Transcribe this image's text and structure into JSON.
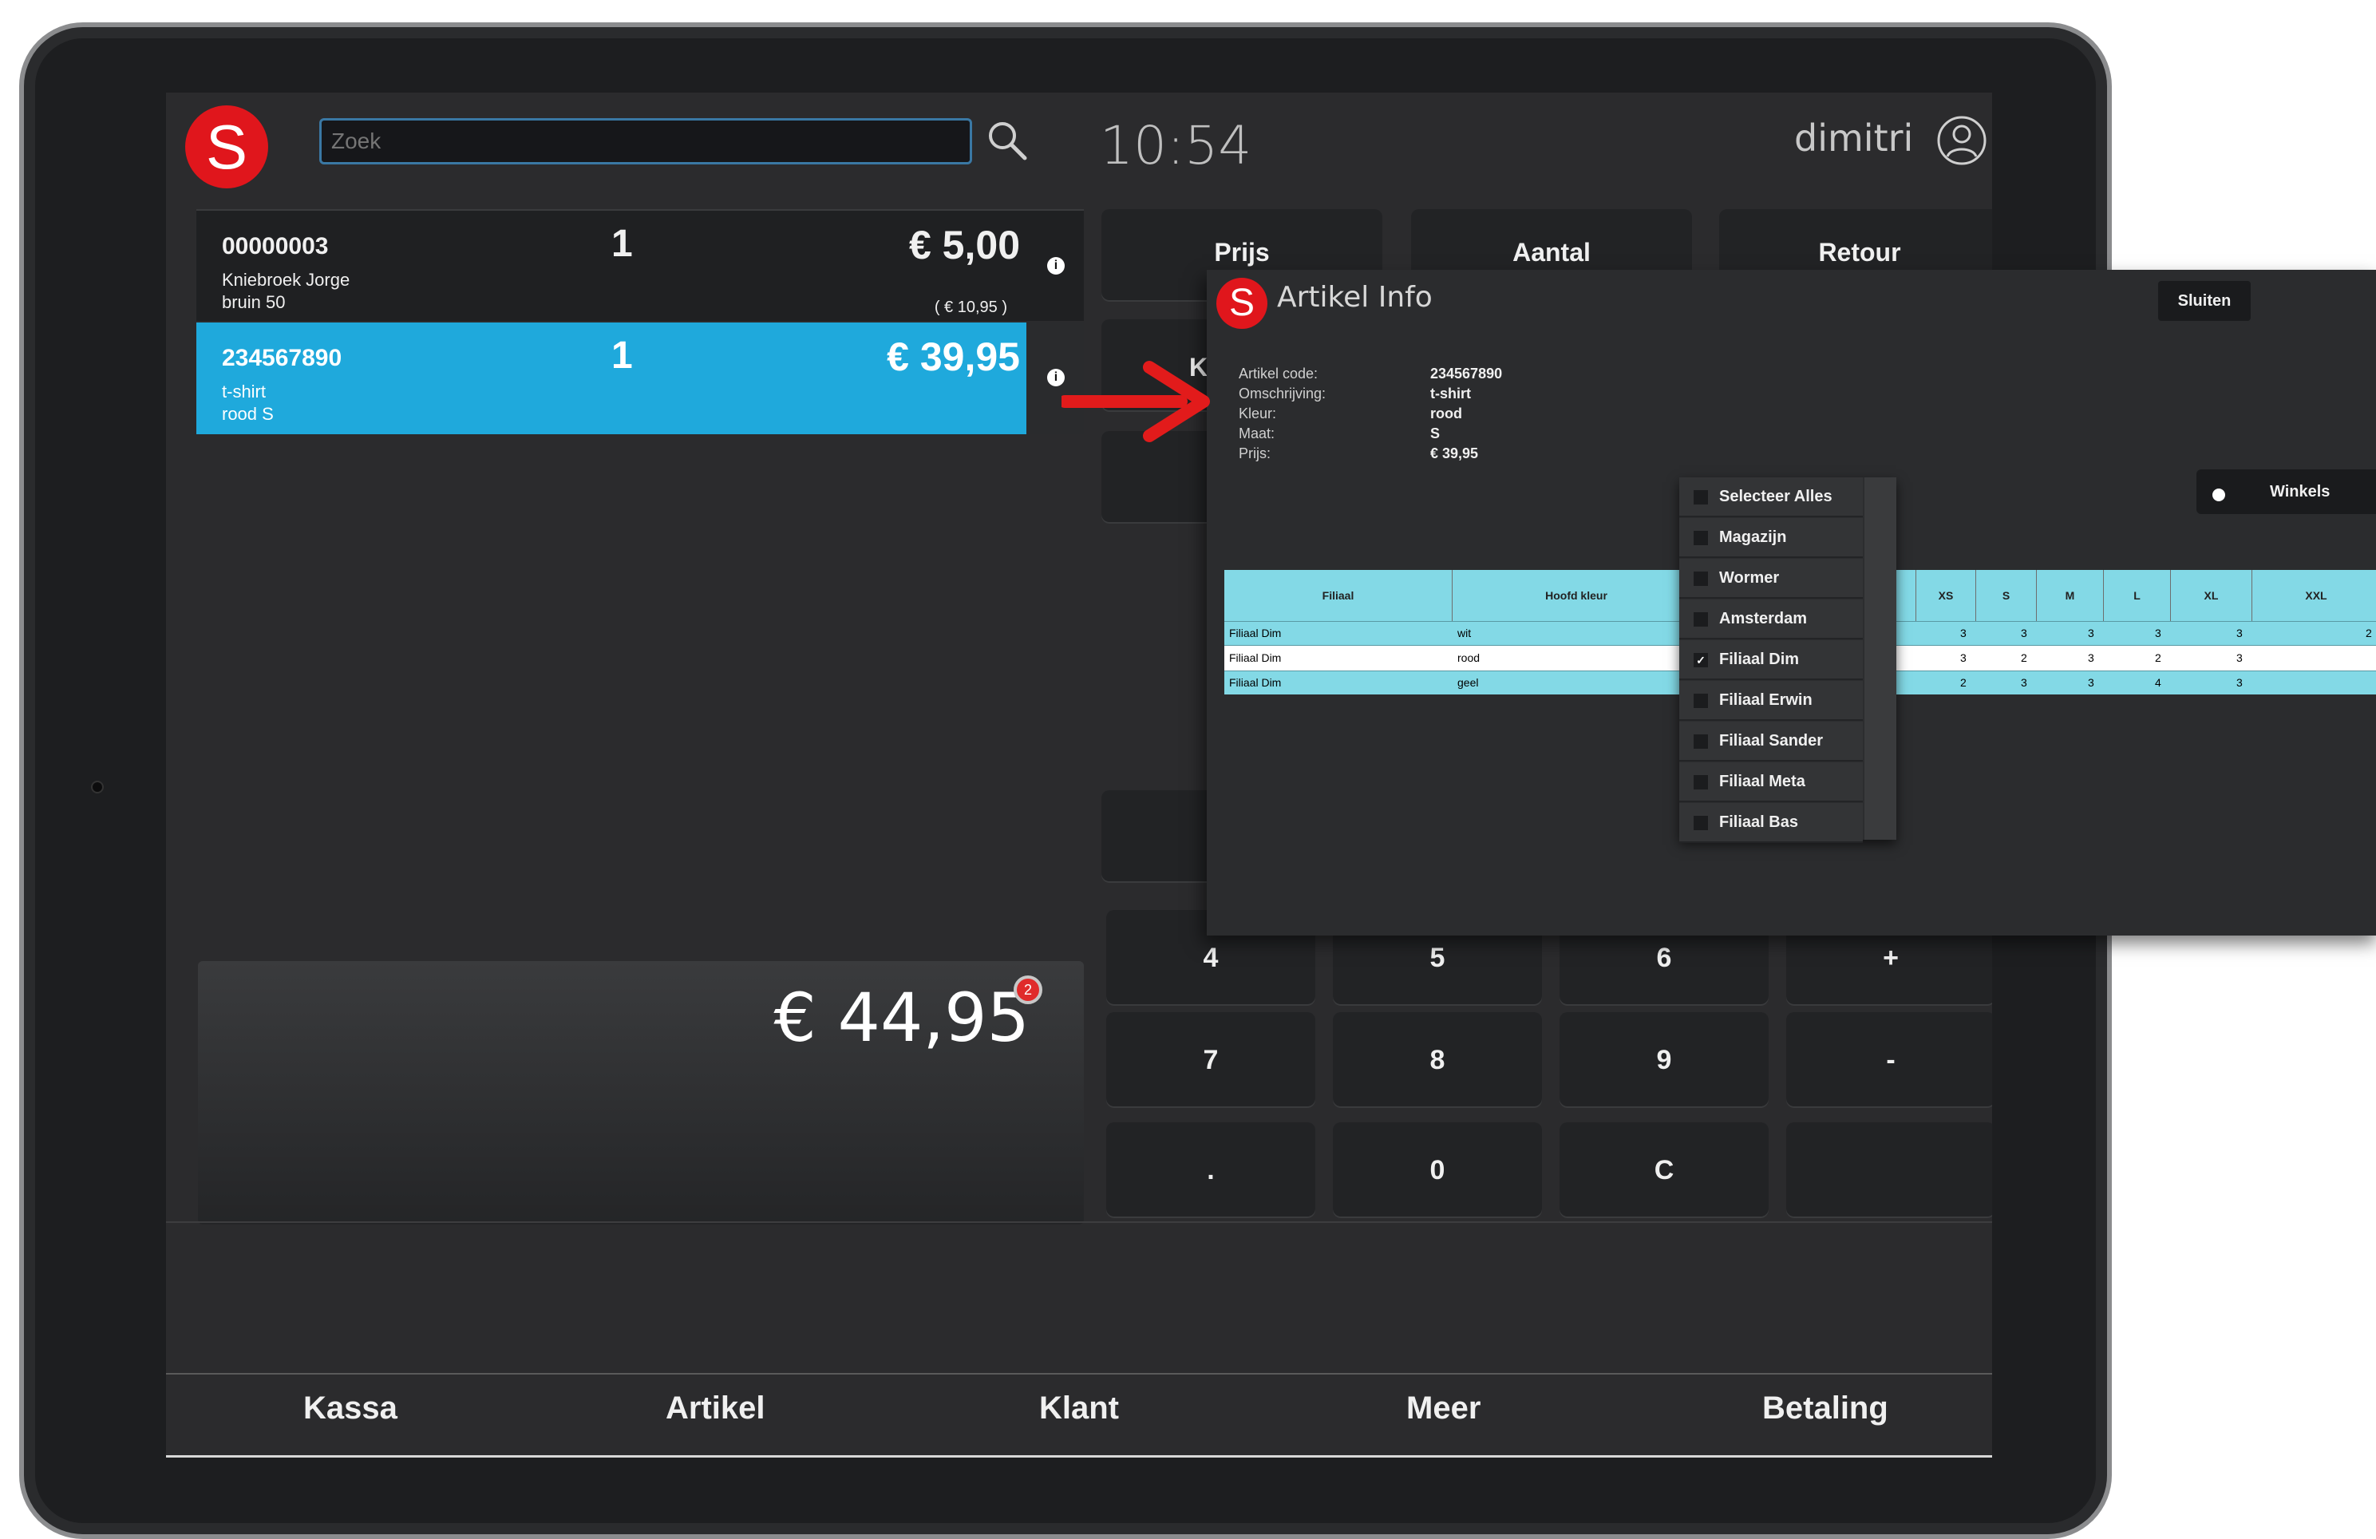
{
  "header": {
    "logo_letter": "S",
    "search_placeholder": "Zoek",
    "clock": "10:54",
    "user": "dimitri"
  },
  "ticket": {
    "rows": [
      {
        "code": "00000003",
        "desc1": "Kniebroek Jorge",
        "desc2": "bruin 50",
        "qty": "1",
        "price": "€ 5,00",
        "old_price": "( € 10,95 )",
        "selected": false
      },
      {
        "code": "234567890",
        "desc1": "t-shirt",
        "desc2": "rood S",
        "qty": "1",
        "price": "€ 39,95",
        "old_price": "",
        "selected": true
      }
    ],
    "info_glyph": "i"
  },
  "total": {
    "amount": "€ 44,95",
    "badge": "2"
  },
  "side_buttons": {
    "prijs": "Prijs",
    "aantal": "Aantal",
    "retour": "Retour",
    "k": "K"
  },
  "keypad": {
    "row1": [
      "4",
      "5",
      "6",
      "+"
    ],
    "row2": [
      "7",
      "8",
      "9",
      "-"
    ],
    "row3": [
      ".",
      "0",
      "C",
      ""
    ]
  },
  "nav": {
    "kassa": "Kassa",
    "artikel": "Artikel",
    "klant": "Klant",
    "meer": "Meer",
    "betaling": "Betaling"
  },
  "dialog": {
    "title": "Artikel Info",
    "close": "Sluiten",
    "labels": [
      "Artikel code:",
      "Omschrijving:",
      "Kleur:",
      "Maat:",
      "Prijs:"
    ],
    "values": [
      "234567890",
      "t-shirt",
      "rood",
      "S",
      "€ 39,95"
    ],
    "winkels": "Winkels",
    "grid_headers": [
      "Filiaal",
      "Hoofd kleur",
      "XS",
      "S",
      "M",
      "L",
      "XL",
      "XXL"
    ],
    "grid_rows": [
      {
        "filiaal": "Filiaal Dim",
        "kleur": "wit",
        "sizes": [
          "3",
          "3",
          "3",
          "3",
          "3",
          "2"
        ]
      },
      {
        "filiaal": "Filiaal Dim",
        "kleur": "rood",
        "sizes": [
          "3",
          "2",
          "3",
          "2",
          "3",
          ""
        ]
      },
      {
        "filiaal": "Filiaal Dim",
        "kleur": "geel",
        "sizes": [
          "2",
          "3",
          "3",
          "4",
          "3",
          ""
        ]
      }
    ],
    "stores": [
      {
        "name": "Selecteer Alles",
        "checked": false
      },
      {
        "name": "Magazijn",
        "checked": false
      },
      {
        "name": "Wormer",
        "checked": false
      },
      {
        "name": "Amsterdam",
        "checked": false
      },
      {
        "name": "Filiaal Dim",
        "checked": true
      },
      {
        "name": "Filiaal Erwin",
        "checked": false
      },
      {
        "name": "Filiaal Sander",
        "checked": false
      },
      {
        "name": "Filiaal Meta",
        "checked": false
      },
      {
        "name": "Filiaal Bas",
        "checked": false
      }
    ]
  },
  "colors": {
    "accent": "#1fa9dc",
    "brand_red": "#e0161c",
    "grid_header": "#83d9e6",
    "screen_bg": "#2b2b2d"
  },
  "icons": {
    "search": "search-icon",
    "user": "user-icon",
    "info": "info-icon",
    "arrow": "arrow-icon"
  }
}
